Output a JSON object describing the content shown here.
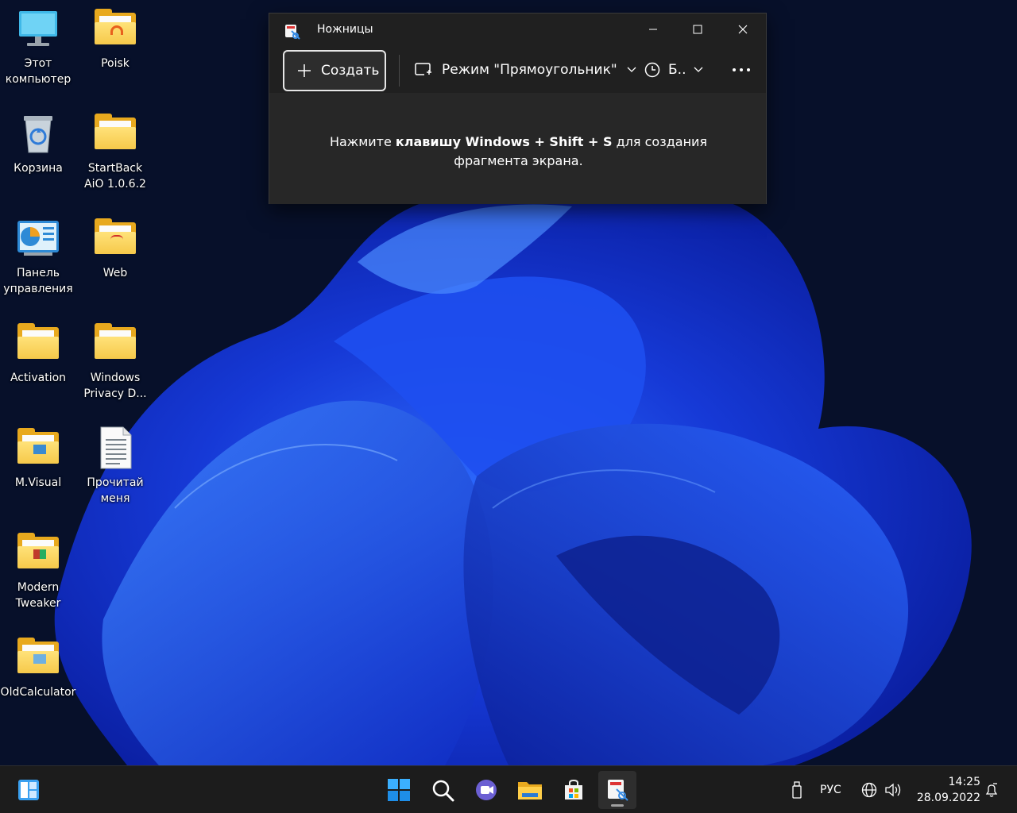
{
  "desktop": {
    "icons": [
      {
        "label": "Этот компьютер",
        "icon": "monitor-icon"
      },
      {
        "label": "Poisk",
        "icon": "folder-icon"
      },
      {
        "label": "Корзина",
        "icon": "recycle-bin-icon"
      },
      {
        "label": "StartBack AiO 1.0.6.2",
        "icon": "folder-icon"
      },
      {
        "label": "Панель управления",
        "icon": "control-panel-icon"
      },
      {
        "label": "Web",
        "icon": "folder-icon"
      },
      {
        "label": "Activation",
        "icon": "folder-icon"
      },
      {
        "label": "Windows Privacy D...",
        "icon": "folder-icon"
      },
      {
        "label": "M.Visual",
        "icon": "folder-icon"
      },
      {
        "label": "Прочитай меня",
        "icon": "text-file-icon"
      },
      {
        "label": "Modern Tweaker",
        "icon": "folder-icon"
      },
      {
        "label": "OldCalculator",
        "icon": "folder-icon"
      }
    ]
  },
  "snipping_tool": {
    "title": "Ножницы",
    "create_label": "Создать",
    "mode_label": "Режим \"Прямоугольник\"",
    "delay_label": "Б..",
    "hint_pre": "Нажмите ",
    "hint_bold": "клавишу Windows + Shift + S",
    "hint_post": " для создания фрагмента экрана."
  },
  "taskbar": {
    "apps": [
      "widgets-icon",
      "start-icon",
      "search-icon",
      "chat-icon",
      "file-explorer-icon",
      "store-icon",
      "snipping-tool-icon"
    ],
    "language": "РУС",
    "time": "14:25",
    "date": "28.09.2022"
  },
  "colors": {
    "accent": "#0a64d8",
    "window_bg": "#202020",
    "taskbar_bg": "#1c1c1c",
    "folder": "#f6c94a"
  }
}
